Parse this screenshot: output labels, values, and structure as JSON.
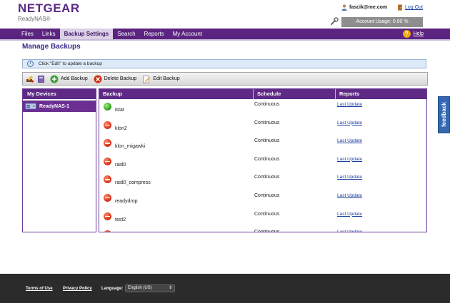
{
  "header": {
    "logo": "NETGEAR",
    "logo_sub": "ReadyNAS®",
    "user_email": "fascik@me.com",
    "logout_label": "Log Out",
    "account_usage": "Account Usage: 0.00 %"
  },
  "nav": {
    "items": [
      "Files",
      "Links",
      "Backup Settings",
      "Search",
      "Reports",
      "My Account"
    ],
    "active": "Backup Settings",
    "help_label": "Help"
  },
  "page_title": "Manage Backups",
  "info_text": "Click \"Edit\" to update a backup",
  "toolbar": {
    "add_label": "Add Backup",
    "delete_label": "Delete Backup",
    "edit_label": "Edit Backup"
  },
  "devices": {
    "header": "My Devices",
    "items": [
      "ReadyNAS-1"
    ]
  },
  "table": {
    "columns": [
      "Backup",
      "Schedule",
      "Reports"
    ],
    "rows": [
      {
        "name": "istat",
        "schedule": "Continuous",
        "report": "Last Update",
        "status": "ok"
      },
      {
        "name": "klon2",
        "schedule": "Continuous",
        "report": "Last Update",
        "status": "error"
      },
      {
        "name": "klon_migawki",
        "schedule": "Continuous",
        "report": "Last Update",
        "status": "error"
      },
      {
        "name": "raid0",
        "schedule": "Continuous",
        "report": "Last Update",
        "status": "error"
      },
      {
        "name": "raid0_compress",
        "schedule": "Continuous",
        "report": "Last Update",
        "status": "error"
      },
      {
        "name": "readydrop",
        "schedule": "Continuous",
        "report": "Last Update",
        "status": "error"
      },
      {
        "name": "test2",
        "schedule": "Continuous",
        "report": "Last Update",
        "status": "error"
      },
      {
        "name": "",
        "schedule": "Continuous",
        "report": "Last Update",
        "status": "error"
      }
    ]
  },
  "feedback_label": "feedback",
  "footer": {
    "terms": "Terms of Use",
    "privacy": "Privacy Policy",
    "language_label": "Language:",
    "language_value": "English (US)"
  },
  "colors": {
    "brand_purple": "#5a2480",
    "accent_blue": "#3568b0",
    "status_ok": "#2a9a1a",
    "status_error": "#d42a10"
  }
}
